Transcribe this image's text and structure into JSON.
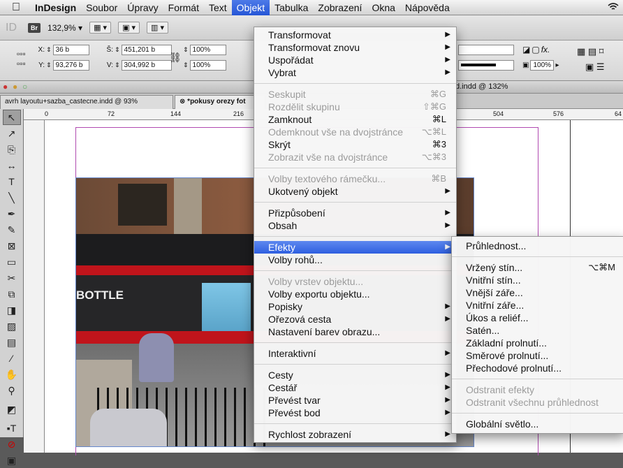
{
  "menubar": {
    "app": "InDesign",
    "items": [
      "Soubor",
      "Úpravy",
      "Formát",
      "Text",
      "Objekt",
      "Tabulka",
      "Zobrazení",
      "Okna",
      "Nápověda"
    ],
    "active": "Objekt"
  },
  "appbar": {
    "br": "Br",
    "zoom": "132,9%"
  },
  "control": {
    "x_label": "X:",
    "x": "36 b",
    "y_label": "Y:",
    "y": "93,276 b",
    "w_label": "Š:",
    "w": "451,201 b",
    "h_label": "V:",
    "h": "304,992 b",
    "scale_x": "100%",
    "scale_y": "100%",
    "opacity": "100%"
  },
  "window": {
    "title_fragment": "d.indd @ 132%"
  },
  "tabs": [
    {
      "label": "avrh layoutu+sazba_castecne.indd @ 93%"
    },
    {
      "label": "*pokusy orezy fot"
    }
  ],
  "ruler": {
    "ticks": [
      "0",
      "72",
      "144",
      "216",
      "504",
      "576",
      "64"
    ]
  },
  "objekt_menu": [
    {
      "type": "item",
      "label": "Transformovat",
      "submenu": true
    },
    {
      "type": "item",
      "label": "Transformovat znovu",
      "submenu": true
    },
    {
      "type": "item",
      "label": "Uspořádat",
      "submenu": true
    },
    {
      "type": "item",
      "label": "Vybrat",
      "submenu": true
    },
    {
      "type": "sep"
    },
    {
      "type": "item",
      "label": "Seskupit",
      "shortcut": "⌘G",
      "disabled": true
    },
    {
      "type": "item",
      "label": "Rozdělit skupinu",
      "shortcut": "⇧⌘G",
      "disabled": true
    },
    {
      "type": "item",
      "label": "Zamknout",
      "shortcut": "⌘L"
    },
    {
      "type": "item",
      "label": "Odemknout vše na dvojstránce",
      "shortcut": "⌥⌘L",
      "disabled": true
    },
    {
      "type": "item",
      "label": "Skrýt",
      "shortcut": "⌘3"
    },
    {
      "type": "item",
      "label": "Zobrazit vše na dvojstránce",
      "shortcut": "⌥⌘3",
      "disabled": true
    },
    {
      "type": "sep"
    },
    {
      "type": "item",
      "label": "Volby textového rámečku...",
      "shortcut": "⌘B",
      "disabled": true
    },
    {
      "type": "item",
      "label": "Ukotvený objekt",
      "submenu": true
    },
    {
      "type": "sep"
    },
    {
      "type": "item",
      "label": "Přizpůsobení",
      "submenu": true
    },
    {
      "type": "item",
      "label": "Obsah",
      "submenu": true
    },
    {
      "type": "sep"
    },
    {
      "type": "item",
      "label": "Efekty",
      "submenu": true,
      "highlighted": true
    },
    {
      "type": "item",
      "label": "Volby rohů..."
    },
    {
      "type": "sep"
    },
    {
      "type": "item",
      "label": "Volby vrstev objektu...",
      "disabled": true
    },
    {
      "type": "item",
      "label": "Volby exportu objektu..."
    },
    {
      "type": "item",
      "label": "Popisky",
      "submenu": true
    },
    {
      "type": "item",
      "label": "Ořezová cesta",
      "submenu": true
    },
    {
      "type": "item",
      "label": "Nastavení barev obrazu..."
    },
    {
      "type": "sep"
    },
    {
      "type": "item",
      "label": "Interaktivní",
      "submenu": true
    },
    {
      "type": "sep"
    },
    {
      "type": "item",
      "label": "Cesty",
      "submenu": true
    },
    {
      "type": "item",
      "label": "Cestář",
      "submenu": true
    },
    {
      "type": "item",
      "label": "Převést tvar",
      "submenu": true
    },
    {
      "type": "item",
      "label": "Převést bod",
      "submenu": true
    },
    {
      "type": "sep"
    },
    {
      "type": "item",
      "label": "Rychlost zobrazení",
      "submenu": true
    }
  ],
  "efekty_menu": [
    {
      "type": "item",
      "label": "Průhlednost..."
    },
    {
      "type": "sep"
    },
    {
      "type": "item",
      "label": "Vržený stín...",
      "shortcut": "⌥⌘M"
    },
    {
      "type": "item",
      "label": "Vnitřní stín..."
    },
    {
      "type": "item",
      "label": "Vnější záře..."
    },
    {
      "type": "item",
      "label": "Vnitřní záře..."
    },
    {
      "type": "item",
      "label": "Úkos a reliéf..."
    },
    {
      "type": "item",
      "label": "Satén..."
    },
    {
      "type": "item",
      "label": "Základní prolnutí..."
    },
    {
      "type": "item",
      "label": "Směrové prolnutí..."
    },
    {
      "type": "item",
      "label": "Přechodové prolnutí..."
    },
    {
      "type": "sep"
    },
    {
      "type": "item",
      "label": "Odstranit efekty",
      "disabled": true
    },
    {
      "type": "item",
      "label": "Odstranit všechnu průhlednost",
      "disabled": true
    },
    {
      "type": "sep"
    },
    {
      "type": "item",
      "label": "Globální světlo..."
    }
  ],
  "photo": {
    "sign_text": "BOTTLE"
  },
  "colors": {
    "accent": "#2e5fe0",
    "margin_guide": "#b04ab0",
    "bus_red": "#c0141b"
  }
}
